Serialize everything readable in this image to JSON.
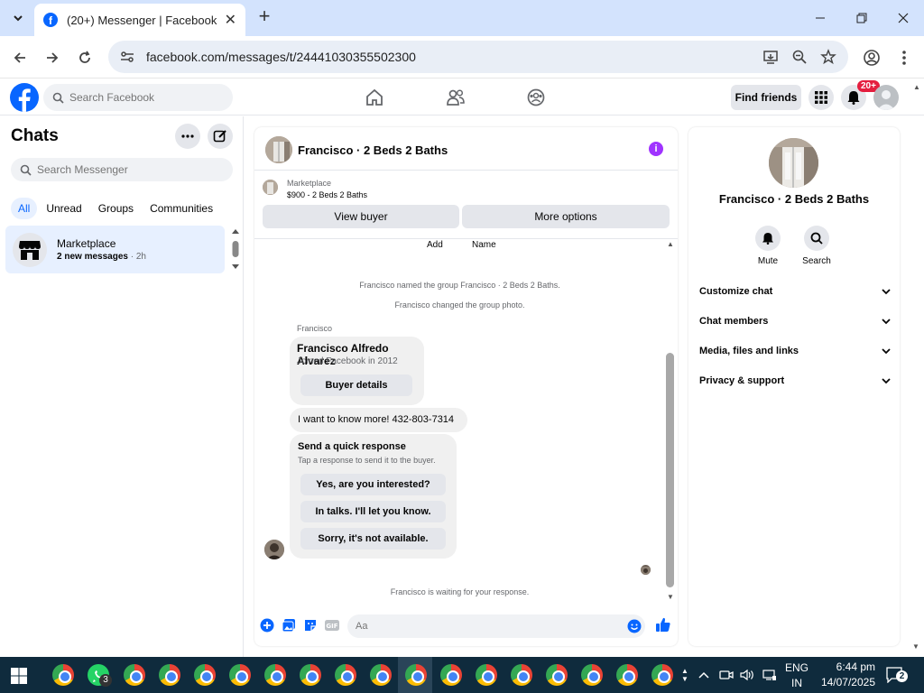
{
  "browser": {
    "tab_title": "(20+) Messenger | Facebook",
    "url": "facebook.com/messages/t/24441030355502300"
  },
  "fb_header": {
    "search_placeholder": "Search Facebook",
    "find_friends": "Find friends",
    "notification_count": "20+"
  },
  "sidebar": {
    "title": "Chats",
    "search_placeholder": "Search Messenger",
    "filters": [
      "All",
      "Unread",
      "Groups",
      "Communities"
    ],
    "active_filter": "All",
    "conversations": [
      {
        "name": "Marketplace",
        "preview": "2 new messages",
        "time": " · 2h"
      }
    ]
  },
  "chat": {
    "title": "Francisco · 2 Beds 2 Baths",
    "marketplace": {
      "label": "Marketplace",
      "listing": "$900 - 2 Beds 2 Baths",
      "view_buyer": "View buyer",
      "more_options": "More options"
    },
    "thread_top": {
      "add": "Add",
      "name": "Name"
    },
    "system_messages": [
      "Francisco named the group Francisco · 2 Beds 2 Baths.",
      "Francisco changed the group photo."
    ],
    "sender": "Francisco",
    "buyer_card": {
      "name": "Francisco Alfredo Alvarez",
      "joined": "Joined Facebook in 2012",
      "button": "Buyer details"
    },
    "message": "I want to know more! 432-803-7314",
    "quick_response": {
      "title": "Send a quick response",
      "subtitle": "Tap a response to send it to the buyer.",
      "options": [
        "Yes, are you interested?",
        "In talks. I'll let you know.",
        "Sorry, it's not available."
      ]
    },
    "waiting": "Francisco is waiting for your response.",
    "composer_placeholder": "Aa"
  },
  "info_panel": {
    "name": "Francisco · 2 Beds 2 Baths",
    "actions": [
      "Mute",
      "Search"
    ],
    "sections": [
      "Customize chat",
      "Chat members",
      "Media, files and links",
      "Privacy & support"
    ]
  },
  "taskbar": {
    "whatsapp_count": "3",
    "lang_line1": "ENG",
    "lang_line2": "IN",
    "time": "6:44 pm",
    "date": "14/07/2025",
    "notifications": "2"
  },
  "colors": {
    "fb_blue": "#0866ff",
    "chrome_tab_strip": "#d3e3fd",
    "taskbar": "#0f2b3d",
    "info_purple": "#a033ff",
    "badge_red": "#e41e3f"
  }
}
